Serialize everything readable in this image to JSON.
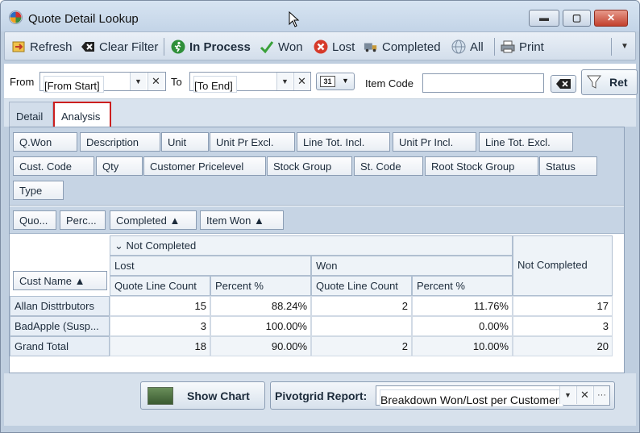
{
  "window": {
    "title": "Quote Detail Lookup",
    "controls": {
      "minimize": "▬",
      "maximize": "▢",
      "close": "✕"
    }
  },
  "toolbar": {
    "refresh": "Refresh",
    "clear_filter": "Clear Filter",
    "in_process": "In Process",
    "won": "Won",
    "lost": "Lost",
    "completed": "Completed",
    "all": "All",
    "print": "Print",
    "more": "▼"
  },
  "filters": {
    "from_label": "From",
    "from_value": "[From Start]",
    "to_label": "To",
    "to_value": "[To End]",
    "calendar_icon_text": "31",
    "item_code_label": "Item Code",
    "item_code_value": "",
    "ret_label": "Ret"
  },
  "tabs": [
    {
      "label": "Detail",
      "active": false
    },
    {
      "label": "Analysis",
      "active": true
    }
  ],
  "pivot": {
    "filter_fields": [
      "Q.Won",
      "Description",
      "Unit",
      "Unit Pr Excl.",
      "Line Tot. Incl.",
      "Unit Pr Incl.",
      "Line Tot. Excl.",
      "Cust. Code",
      "Qty",
      "Customer Pricelevel",
      "Stock Group",
      "St. Code",
      "Root Stock Group",
      "Status",
      "Type"
    ],
    "data_fields": [
      "Quo...",
      "Perc..."
    ],
    "column_fields": [
      "Completed ▲",
      "Item Won ▲"
    ],
    "row_field": "Cust Name ▲",
    "group_header": "⌄ Not Completed",
    "lost_label": "Lost",
    "won_label": "Won",
    "not_completed_label": "Not Completed",
    "measure_headers": [
      "Quote Line Count",
      "Percent %",
      "Quote Line Count",
      "Percent %"
    ],
    "rows": [
      {
        "name": "Allan Disttrbutors",
        "lost_count": "15",
        "lost_pct": "88.24%",
        "won_count": "2",
        "won_pct": "11.76%",
        "not_completed": "17"
      },
      {
        "name": "BadApple (Susp...",
        "lost_count": "3",
        "lost_pct": "100.00%",
        "won_count": "",
        "won_pct": "0.00%",
        "not_completed": "3"
      },
      {
        "name": "Grand Total",
        "lost_count": "18",
        "lost_pct": "90.00%",
        "won_count": "2",
        "won_pct": "10.00%",
        "not_completed": "20"
      }
    ]
  },
  "bottom": {
    "show_chart": "Show Chart",
    "report_label": "Pivotgrid Report:",
    "report_value": "Breakdown Won/Lost per Customer",
    "ellipsis": "···"
  }
}
